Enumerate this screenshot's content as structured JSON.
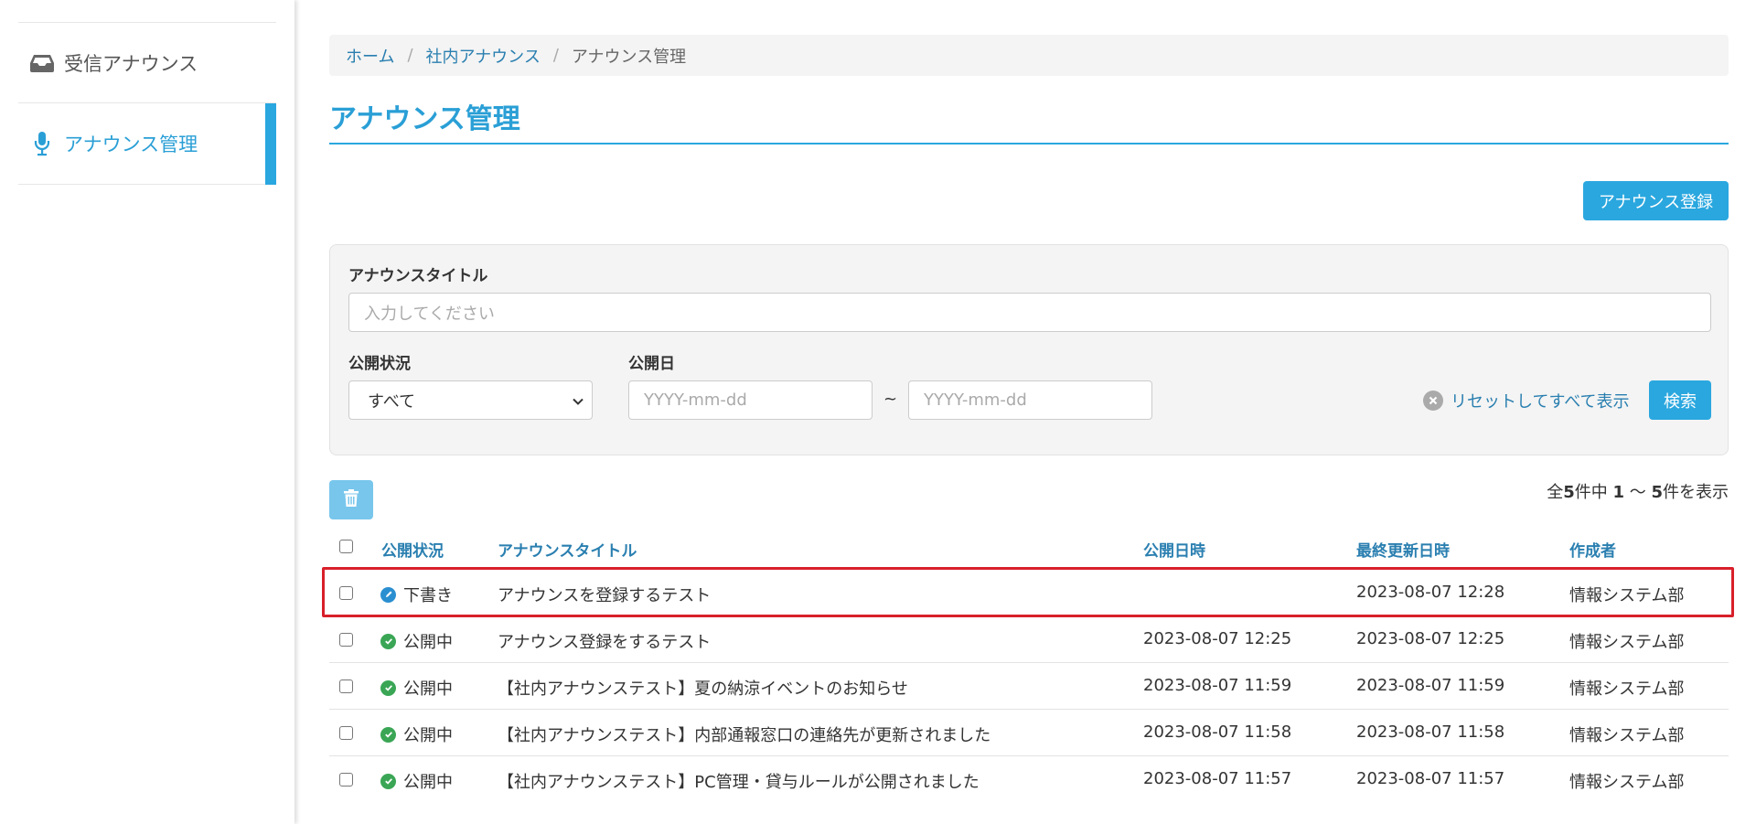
{
  "sidebar": {
    "items": [
      {
        "label": "受信アナウンス",
        "icon": "inbox-icon"
      },
      {
        "label": "アナウンス管理",
        "icon": "microphone-icon",
        "active": true
      }
    ]
  },
  "breadcrumb": {
    "home": "ホーム",
    "parent": "社内アナウンス",
    "current": "アナウンス管理",
    "separator": "/"
  },
  "page_title": "アナウンス管理",
  "register_button": "アナウンス登録",
  "search": {
    "title_label": "アナウンスタイトル",
    "title_placeholder": "入力してください",
    "status_label": "公開状況",
    "status_value": "すべて",
    "date_label": "公開日",
    "date_from_placeholder": "YYYY-mm-dd",
    "date_to_placeholder": "YYYY-mm-dd",
    "tilde": "~",
    "reset_label": "リセットしてすべて表示",
    "search_button": "検索"
  },
  "result_count": {
    "prefix": "全",
    "total": "5",
    "mid1": "件中 ",
    "from": "1",
    "mid2": " 〜 ",
    "to": "5",
    "suffix": "件を表示"
  },
  "table": {
    "headers": {
      "status": "公開状況",
      "title": "アナウンスタイトル",
      "published": "公開日時",
      "updated": "最終更新日時",
      "author": "作成者"
    },
    "rows": [
      {
        "status": "下書き",
        "status_type": "draft",
        "title": "アナウンスを登録するテスト",
        "published": "",
        "updated": "2023-08-07 12:28",
        "author": "情報システム部"
      },
      {
        "status": "公開中",
        "status_type": "published",
        "title": "アナウンス登録をするテスト",
        "published": "2023-08-07 12:25",
        "updated": "2023-08-07 12:25",
        "author": "情報システム部"
      },
      {
        "status": "公開中",
        "status_type": "published",
        "title": "【社内アナウンステスト】夏の納涼イベントのお知らせ",
        "published": "2023-08-07 11:59",
        "updated": "2023-08-07 11:59",
        "author": "情報システム部"
      },
      {
        "status": "公開中",
        "status_type": "published",
        "title": "【社内アナウンステスト】内部通報窓口の連絡先が更新されました",
        "published": "2023-08-07 11:58",
        "updated": "2023-08-07 11:58",
        "author": "情報システム部"
      },
      {
        "status": "公開中",
        "status_type": "published",
        "title": "【社内アナウンステスト】PC管理・貸与ルールが公開されました",
        "published": "2023-08-07 11:57",
        "updated": "2023-08-07 11:57",
        "author": "情報システム部"
      }
    ]
  },
  "colors": {
    "accent": "#2aa7df",
    "published_green": "#3aa655",
    "draft_blue": "#2a8fd0",
    "highlight_red": "#d8202a"
  }
}
